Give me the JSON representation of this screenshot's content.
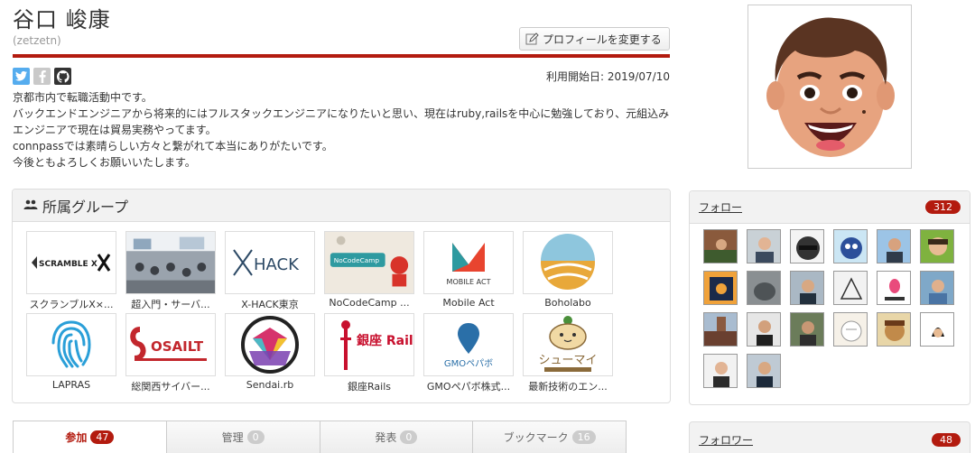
{
  "profile": {
    "name": "谷口 峻康",
    "handle": "(zetzetn)",
    "edit_label": "プロフィールを変更する",
    "since": "利用開始日: 2019/07/10",
    "bio": [
      "京都市内で転職活動中です。",
      "バックエンドエンジニアから将来的にはフルスタックエンジニアになりたいと思い、現在はruby,railsを中心に勉強しており、元組込みエンジニアで現在は貿易実務やってます。",
      "connpassでは素晴らしい方々と繋がれて本当にありがたいです。",
      "今後ともよろしくお願いいたします。"
    ]
  },
  "groups": {
    "title": "所属グループ",
    "items": [
      {
        "label": "スクランブルX×...",
        "logo_text": "SCRAMBLE X"
      },
      {
        "label": "超入門・サーバ...",
        "logo_text": ""
      },
      {
        "label": "X-HACK東京",
        "logo_text": "HACK"
      },
      {
        "label": "NoCodeCamp ...",
        "logo_text": "NoCodeCamp"
      },
      {
        "label": "Mobile Act",
        "logo_text": "MOBILE ACT"
      },
      {
        "label": "Boholabo",
        "logo_text": ""
      },
      {
        "label": "LAPRAS",
        "logo_text": ""
      },
      {
        "label": "総関西サイバー...",
        "logo_text": "OSAILT"
      },
      {
        "label": "Sendai.rb",
        "logo_text": ""
      },
      {
        "label": "銀座Rails",
        "logo_text": "銀座 Rails"
      },
      {
        "label": "GMOペパボ株式...",
        "logo_text": "GMOペパボ"
      },
      {
        "label": "最新技術のエン...",
        "logo_text": "シューマイ"
      }
    ]
  },
  "tabs": [
    {
      "label": "参加",
      "count": "47",
      "active": true
    },
    {
      "label": "管理",
      "count": "0",
      "active": false
    },
    {
      "label": "発表",
      "count": "0",
      "active": false
    },
    {
      "label": "ブックマーク",
      "count": "16",
      "active": false
    }
  ],
  "follow": {
    "title": "フォロー",
    "count": "312"
  },
  "followers": {
    "title": "フォロワー",
    "count": "48"
  },
  "colors": {
    "accent": "#b31b0f",
    "twitter": "#55acee"
  }
}
